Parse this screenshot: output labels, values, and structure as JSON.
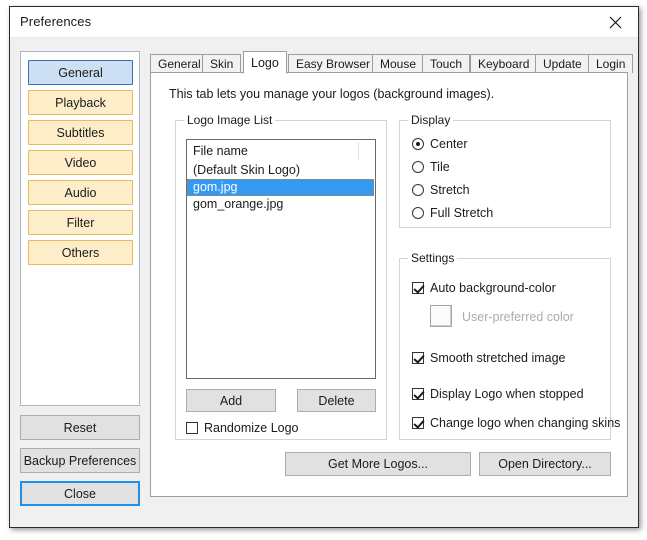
{
  "window": {
    "title": "Preferences",
    "close_icon": "close-icon"
  },
  "sidebar": {
    "items": [
      {
        "label": "General",
        "selected": true
      },
      {
        "label": "Playback",
        "selected": false
      },
      {
        "label": "Subtitles",
        "selected": false
      },
      {
        "label": "Video",
        "selected": false
      },
      {
        "label": "Audio",
        "selected": false
      },
      {
        "label": "Filter",
        "selected": false
      },
      {
        "label": "Others",
        "selected": false
      }
    ],
    "reset_label": "Reset",
    "backup_label": "Backup Preferences",
    "close_label": "Close"
  },
  "tabs": [
    {
      "label": "General",
      "active": false
    },
    {
      "label": "Skin",
      "active": false
    },
    {
      "label": "Logo",
      "active": true
    },
    {
      "label": "Easy Browser",
      "active": false
    },
    {
      "label": "Mouse",
      "active": false
    },
    {
      "label": "Touch",
      "active": false
    },
    {
      "label": "Keyboard",
      "active": false
    },
    {
      "label": "Update",
      "active": false
    },
    {
      "label": "Login",
      "active": false
    }
  ],
  "page": {
    "description": "This tab lets you manage your logos (background images).",
    "logo_list": {
      "group_label": "Logo Image List",
      "column_header": "File name",
      "rows": [
        {
          "name": "(Default Skin Logo)",
          "selected": false
        },
        {
          "name": "gom.jpg",
          "selected": true
        },
        {
          "name": "gom_orange.jpg",
          "selected": false
        }
      ],
      "add_label": "Add",
      "delete_label": "Delete",
      "randomize_label": "Randomize Logo",
      "randomize_checked": false
    },
    "display": {
      "group_label": "Display",
      "options": [
        {
          "label": "Center",
          "checked": true
        },
        {
          "label": "Tile",
          "checked": false
        },
        {
          "label": "Stretch",
          "checked": false
        },
        {
          "label": "Full Stretch",
          "checked": false
        }
      ]
    },
    "settings": {
      "group_label": "Settings",
      "auto_bg_label": "Auto background-color",
      "auto_bg_checked": true,
      "user_color_label": "User-preferred color",
      "smooth_label": "Smooth stretched image",
      "smooth_checked": true,
      "display_logo_label": "Display Logo when stopped",
      "display_logo_checked": true,
      "change_logo_label": "Change logo when changing skins",
      "change_logo_checked": true
    },
    "get_more_logos_label": "Get More Logos...",
    "open_directory_label": "Open Directory..."
  },
  "colors": {
    "selection_blue": "#3399f2",
    "sidebar_selected_fill": "#cddff2",
    "sidebar_selected_border": "#3f6fa8",
    "sidebar_item_fill": "#fdeec9",
    "sidebar_item_border": "#e9b960",
    "focus_border": "#1e90e8",
    "dialog_bg": "#f0f0f0"
  }
}
